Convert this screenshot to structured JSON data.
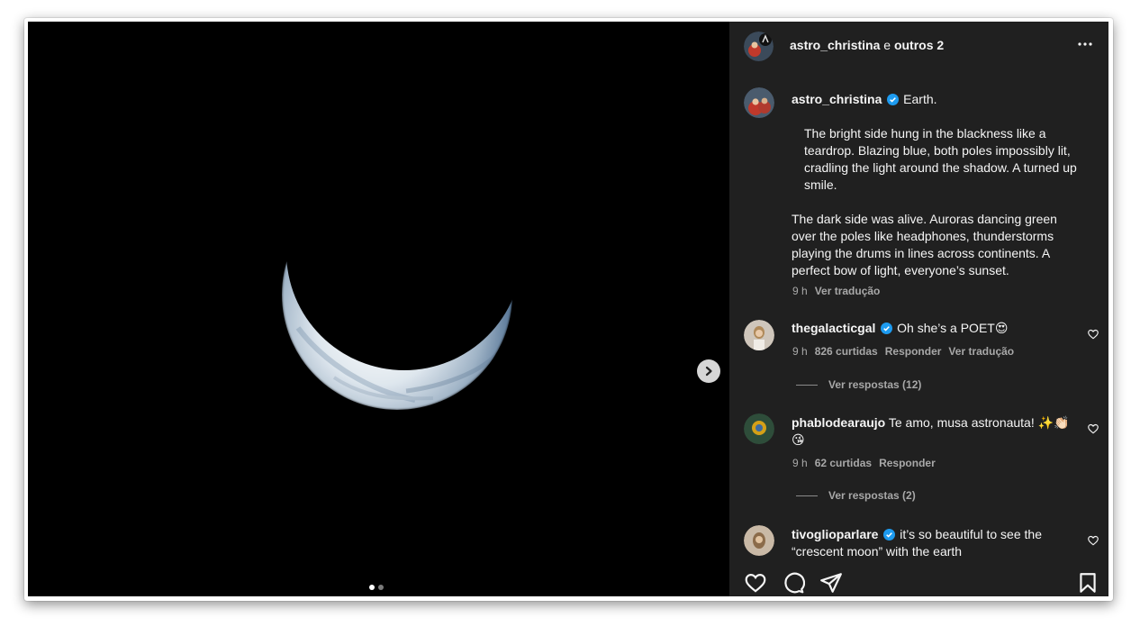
{
  "header": {
    "username": "astro_christina",
    "and_others": "e",
    "others_count": "outros 2",
    "more_icon": "more-horizontal-icon"
  },
  "caption": {
    "username": "astro_christina",
    "verified_icon": "verified-badge-icon",
    "first_line": "Earth.",
    "paragraph_1": "The bright side hung in the blackness like a teardrop. Blazing blue, both poles impossibly lit, cradling the light around the shadow. A turned up smile.",
    "paragraph_2": "The dark side was alive. Auroras dancing green over the poles like headphones, thunderstorms playing the drums in lines across continents. A perfect bow of light, everyone’s sunset.",
    "time": "9 h",
    "translate": "Ver tradução"
  },
  "comments": [
    {
      "username": "thegalacticgal",
      "verified": true,
      "text": "Oh she’s a POET😍",
      "time": "9 h",
      "likes": "826 curtidas",
      "reply": "Responder",
      "translate": "Ver tradução",
      "view_replies": "Ver respostas (12)"
    },
    {
      "username": "phablodearaujo",
      "verified": false,
      "text": "Te amo, musa astronauta! ✨👏🏻😘",
      "time": "9 h",
      "likes": "62 curtidas",
      "reply": "Responder",
      "view_replies": "Ver respostas (2)"
    },
    {
      "username": "tivoglioparlare",
      "verified": true,
      "text": "it’s so beautiful to see the “crescent moon” with the earth"
    }
  ],
  "media": {
    "image": "crescent-earth-photo",
    "carousel_position": "1 of 2",
    "next_icon": "chevron-right-icon"
  },
  "actions": {
    "like_icon": "heart-icon",
    "comment_icon": "comment-icon",
    "share_icon": "send-icon",
    "save_icon": "bookmark-icon"
  },
  "colors": {
    "panel_bg": "#202020",
    "media_bg": "#000000",
    "verified": "#1d9bf0",
    "muted_text": "#a8a8a8"
  }
}
